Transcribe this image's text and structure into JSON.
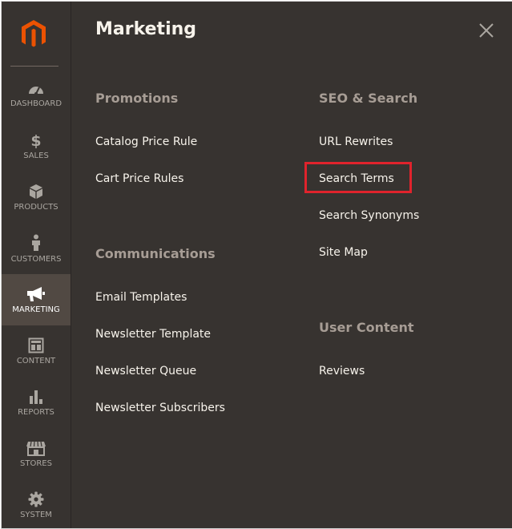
{
  "sidebar": {
    "items": [
      {
        "label": "DASHBOARD",
        "icon": "gauge-icon"
      },
      {
        "label": "SALES",
        "icon": "dollar-icon"
      },
      {
        "label": "PRODUCTS",
        "icon": "box-icon"
      },
      {
        "label": "CUSTOMERS",
        "icon": "person-icon"
      },
      {
        "label": "MARKETING",
        "icon": "megaphone-icon",
        "active": true
      },
      {
        "label": "CONTENT",
        "icon": "layout-icon"
      },
      {
        "label": "REPORTS",
        "icon": "bar-chart-icon"
      },
      {
        "label": "STORES",
        "icon": "storefront-icon"
      },
      {
        "label": "SYSTEM",
        "icon": "gear-icon"
      }
    ]
  },
  "panel": {
    "title": "Marketing",
    "sections": {
      "promotions": {
        "title": "Promotions",
        "links": [
          "Catalog Price Rule",
          "Cart Price Rules"
        ]
      },
      "communications": {
        "title": "Communications",
        "links": [
          "Email Templates",
          "Newsletter Template",
          "Newsletter Queue",
          "Newsletter Subscribers"
        ]
      },
      "seo_search": {
        "title": "SEO & Search",
        "links": [
          "URL Rewrites",
          "Search Terms",
          "Search Synonyms",
          "Site Map"
        ]
      },
      "user_content": {
        "title": "User Content",
        "links": [
          "Reviews"
        ]
      }
    }
  },
  "colors": {
    "background": "#373330",
    "active_nav": "#514943",
    "brand_orange": "#eb5202",
    "highlight": "#e0232c",
    "section_title": "#a79d95",
    "link": "#f7f3eb"
  }
}
